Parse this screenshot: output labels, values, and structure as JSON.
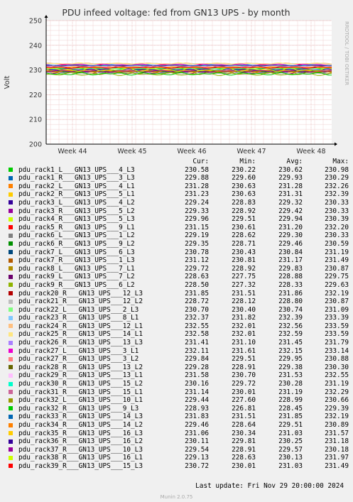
{
  "chart_data": {
    "type": "line",
    "title": "PDU infeed voltage: fed from GN13 UPS - by month",
    "ylabel": "Volt",
    "ylim": [
      200,
      250
    ],
    "yticks": [
      200,
      210,
      220,
      230,
      240,
      250
    ],
    "xticks": [
      "Week 44",
      "Week 45",
      "Week 46",
      "Week 47",
      "Week 48"
    ],
    "side_label": "RRDTOOL / TOBI OETIKER",
    "grid": true,
    "legend_headers": [
      "Cur:",
      "Min:",
      "Avg:",
      "Max:"
    ],
    "series": [
      {
        "name": "pdu_rack1_L___GN13_UPS___4_L3",
        "color": "#00cc00",
        "cur": "230.58",
        "min": "230.22",
        "avg": "230.62",
        "max": "230.98"
      },
      {
        "name": "pdu_rack1_R___GN13_UPS___3_L3",
        "color": "#0066b3",
        "cur": "229.88",
        "min": "229.60",
        "avg": "229.93",
        "max": "230.29"
      },
      {
        "name": "pdu_rack2_L___GN13_UPS___4_L1",
        "color": "#ff8000",
        "cur": "231.28",
        "min": "230.63",
        "avg": "231.28",
        "max": "232.26"
      },
      {
        "name": "pdu_rack2_R___GN13_UPS___5_L1",
        "color": "#ffcc00",
        "cur": "231.23",
        "min": "230.63",
        "avg": "231.31",
        "max": "232.39"
      },
      {
        "name": "pdu_rack3_L___GN13_UPS___4_L2",
        "color": "#330099",
        "cur": "229.24",
        "min": "228.83",
        "avg": "229.32",
        "max": "230.33"
      },
      {
        "name": "pdu_rack3_R___GN13_UPS___5_L2",
        "color": "#990099",
        "cur": "229.33",
        "min": "228.92",
        "avg": "229.42",
        "max": "230.33"
      },
      {
        "name": "pdu_rack4_R___GN13_UPS___5_L3",
        "color": "#ccff00",
        "cur": "229.96",
        "min": "229.51",
        "avg": "229.94",
        "max": "230.39"
      },
      {
        "name": "pdu_rack5_R___GN13_UPS___9_L1",
        "color": "#ff0000",
        "cur": "231.15",
        "min": "230.61",
        "avg": "231.20",
        "max": "232.20"
      },
      {
        "name": "pdu_rack6_L___GN13_UPS___1_L2",
        "color": "#808080",
        "cur": "229.19",
        "min": "228.62",
        "avg": "229.30",
        "max": "230.33"
      },
      {
        "name": "pdu_rack6_R___GN13_UPS___9_L2",
        "color": "#008f00",
        "cur": "229.35",
        "min": "228.71",
        "avg": "229.46",
        "max": "230.59"
      },
      {
        "name": "pdu_rack7_L___GN13_UPS___6_L3",
        "color": "#00487d",
        "cur": "230.78",
        "min": "230.43",
        "avg": "230.84",
        "max": "231.19"
      },
      {
        "name": "pdu_rack7_R___GN13_UPS___1_L3",
        "color": "#b35a00",
        "cur": "231.12",
        "min": "230.81",
        "avg": "231.17",
        "max": "231.49"
      },
      {
        "name": "pdu_rack8_L___GN13_UPS___7_L1",
        "color": "#b38f00",
        "cur": "229.72",
        "min": "228.92",
        "avg": "229.83",
        "max": "230.87"
      },
      {
        "name": "pdu_rack9_L___GN13_UPS___7_L2",
        "color": "#6b006b",
        "cur": "228.63",
        "min": "227.75",
        "avg": "228.88",
        "max": "229.75"
      },
      {
        "name": "pdu_rack9_R___GN13_UPS___6_L2",
        "color": "#8fb300",
        "cur": "228.50",
        "min": "227.32",
        "avg": "228.33",
        "max": "229.63"
      },
      {
        "name": "pdu_rack20_R___GN13_UPS___12_L3",
        "color": "#b30000",
        "cur": "231.85",
        "min": "231.51",
        "avg": "231.86",
        "max": "232.19"
      },
      {
        "name": "pdu_rack21_R___GN13_UPS___12_L2",
        "color": "#bebebe",
        "cur": "228.72",
        "min": "228.12",
        "avg": "228.80",
        "max": "230.87"
      },
      {
        "name": "pdu_rack22_L___GN13_UPS___2_L3",
        "color": "#80ff80",
        "cur": "230.70",
        "min": "230.40",
        "avg": "230.74",
        "max": "231.09"
      },
      {
        "name": "pdu_rack23_R___GN13_UPS___8_L1",
        "color": "#80c9ff",
        "cur": "232.37",
        "min": "231.82",
        "avg": "232.39",
        "max": "233.39"
      },
      {
        "name": "pdu_rack24_R___GN13_UPS___12_L1",
        "color": "#ffc080",
        "cur": "232.55",
        "min": "232.01",
        "avg": "232.56",
        "max": "233.59"
      },
      {
        "name": "pdu_rack25_R___GN13_UPS___14_L1",
        "color": "#ffe680",
        "cur": "232.58",
        "min": "232.01",
        "avg": "232.59",
        "max": "233.59"
      },
      {
        "name": "pdu_rack26_R___GN13_UPS___13_L3",
        "color": "#aa80ff",
        "cur": "231.41",
        "min": "231.10",
        "avg": "231.45",
        "max": "231.79"
      },
      {
        "name": "pdu_rack27_L___GN13_UPS___3_L1",
        "color": "#ee00cc",
        "cur": "232.11",
        "min": "231.61",
        "avg": "232.15",
        "max": "233.14"
      },
      {
        "name": "pdu_rack27_R___GN13_UPS___3_L2",
        "color": "#ff8080",
        "cur": "229.84",
        "min": "229.51",
        "avg": "229.95",
        "max": "230.88"
      },
      {
        "name": "pdu_rack28_R___GN13_UPS___13_L2",
        "color": "#666600",
        "cur": "229.28",
        "min": "228.91",
        "avg": "229.38",
        "max": "230.30"
      },
      {
        "name": "pdu_rack29_R___GN13_UPS___13_L1",
        "color": "#ffbfff",
        "cur": "231.58",
        "min": "230.70",
        "avg": "231.53",
        "max": "232.55"
      },
      {
        "name": "pdu_rack30_R___GN13_UPS___15_L2",
        "color": "#00ffcc",
        "cur": "230.16",
        "min": "229.72",
        "avg": "230.28",
        "max": "231.19"
      },
      {
        "name": "pdu_rack31_R___GN13_UPS___15_L1",
        "color": "#cc6699",
        "cur": "231.14",
        "min": "230.01",
        "avg": "231.19",
        "max": "232.29"
      },
      {
        "name": "pdu_rack32_L___GN13_UPS___10_L1",
        "color": "#999900",
        "cur": "229.44",
        "min": "227.60",
        "avg": "228.99",
        "max": "230.66"
      },
      {
        "name": "pdu_rack32_R___GN13_UPS___9_L3",
        "color": "#00cc00",
        "cur": "228.93",
        "min": "226.81",
        "avg": "228.45",
        "max": "229.39"
      },
      {
        "name": "pdu_rack33_R___GN13_UPS___14_L3",
        "color": "#0066b3",
        "cur": "231.83",
        "min": "231.51",
        "avg": "231.85",
        "max": "232.19"
      },
      {
        "name": "pdu_rack34_R___GN13_UPS___14_L2",
        "color": "#ff8000",
        "cur": "229.46",
        "min": "228.64",
        "avg": "229.51",
        "max": "230.89"
      },
      {
        "name": "pdu_rack35_R___GN13_UPS___16_L3",
        "color": "#ffcc00",
        "cur": "231.06",
        "min": "230.34",
        "avg": "231.03",
        "max": "231.57"
      },
      {
        "name": "pdu_rack36_R___GN13_UPS___16_L2",
        "color": "#330099",
        "cur": "230.11",
        "min": "229.81",
        "avg": "230.25",
        "max": "231.18"
      },
      {
        "name": "pdu_rack37_R___GN13_UPS___10_L3",
        "color": "#990099",
        "cur": "229.54",
        "min": "228.91",
        "avg": "229.57",
        "max": "230.18"
      },
      {
        "name": "pdu_rack38_R___GN13_UPS___16_L1",
        "color": "#ccff00",
        "cur": "229.13",
        "min": "228.63",
        "avg": "230.13",
        "max": "231.97"
      },
      {
        "name": "pdu_rack39_R___GN13_UPS___15_L3",
        "color": "#ff0000",
        "cur": "230.72",
        "min": "230.01",
        "avg": "231.03",
        "max": "231.49"
      }
    ]
  },
  "footer": {
    "last_update": "Last update: Fri Nov 29 20:00:00 2024",
    "munin": "Munin 2.0.75"
  }
}
